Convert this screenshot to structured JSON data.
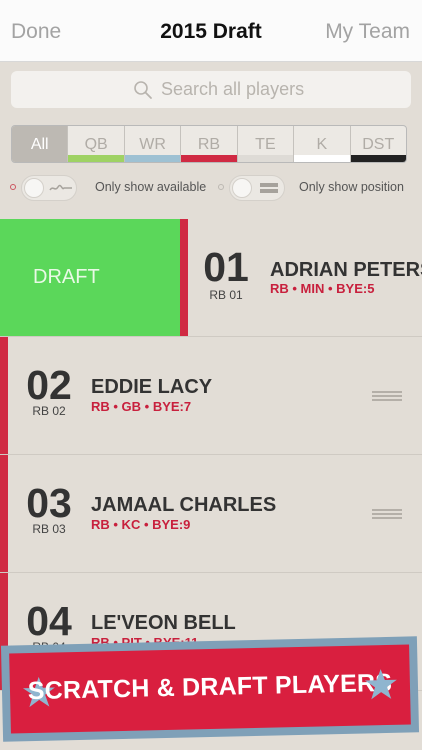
{
  "nav": {
    "left": "Done",
    "title": "2015 Draft",
    "right": "My Team"
  },
  "search": {
    "placeholder": "Search all players",
    "icon": "search-icon"
  },
  "filters": {
    "segments": [
      {
        "label": "All",
        "color": ""
      },
      {
        "label": "QB",
        "color": "#9fd264"
      },
      {
        "label": "WR",
        "color": "#9ec1d3"
      },
      {
        "label": "RB",
        "color": "#d02a43"
      },
      {
        "label": "TE",
        "color": "#dedbd6"
      },
      {
        "label": "K",
        "color": "#ffffff"
      },
      {
        "label": "DST",
        "color": "#222222"
      }
    ],
    "active": "All"
  },
  "toggles": {
    "available_label": "Only show available",
    "position_label": "Only show position"
  },
  "draft_action": {
    "label": "DRAFT",
    "color": "#5bd75a"
  },
  "players": [
    {
      "rank": "01",
      "pos_rank": "RB 01",
      "name": "ADRIAN PETERSON",
      "info": "RB • MIN • BYE:5"
    },
    {
      "rank": "02",
      "pos_rank": "RB 02",
      "name": "EDDIE LACY",
      "info": "RB • GB • BYE:7"
    },
    {
      "rank": "03",
      "pos_rank": "RB 03",
      "name": "JAMAAL CHARLES",
      "info": "RB • KC • BYE:9"
    },
    {
      "rank": "04",
      "pos_rank": "RB 04",
      "name": "LE'VEON BELL",
      "info": "RB • PIT • BYE:11"
    }
  ],
  "banner": {
    "text": "SCRATCH & DRAFT PLAYERS",
    "color": "#d91f3f",
    "icon": "star-icon"
  },
  "colors": {
    "accent_red": "#d02a43",
    "background": "#e2ddd6"
  }
}
